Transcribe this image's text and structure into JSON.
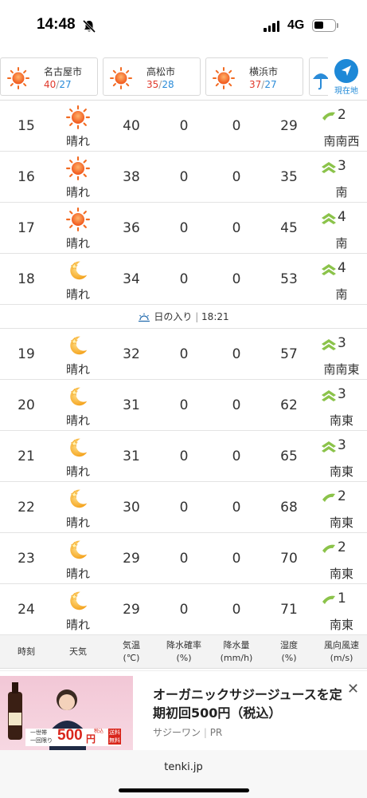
{
  "status": {
    "time": "14:48",
    "network": "4G"
  },
  "cities": [
    {
      "name": "名古屋市",
      "high": "40",
      "low": "27",
      "icon": "sun-icon"
    },
    {
      "name": "高松市",
      "high": "35",
      "low": "28",
      "icon": "sun-icon"
    },
    {
      "name": "横浜市",
      "high": "37",
      "low": "27",
      "icon": "sun-icon"
    }
  ],
  "locate_label": "現在地",
  "rows_before_sunset": [
    {
      "hour": "15",
      "icon": "sun-icon",
      "weather": "晴れ",
      "temp": "40",
      "prob": "0",
      "amount": "0",
      "humidity": "29",
      "speed": "2",
      "dir": "南南西",
      "wind_level": 1
    },
    {
      "hour": "16",
      "icon": "sun-icon",
      "weather": "晴れ",
      "temp": "38",
      "prob": "0",
      "amount": "0",
      "humidity": "35",
      "speed": "3",
      "dir": "南",
      "wind_level": 2
    },
    {
      "hour": "17",
      "icon": "sun-icon",
      "weather": "晴れ",
      "temp": "36",
      "prob": "0",
      "amount": "0",
      "humidity": "45",
      "speed": "4",
      "dir": "南",
      "wind_level": 2
    },
    {
      "hour": "18",
      "icon": "moon-icon",
      "weather": "晴れ",
      "temp": "34",
      "prob": "0",
      "amount": "0",
      "humidity": "53",
      "speed": "4",
      "dir": "南",
      "wind_level": 2
    }
  ],
  "sunset": {
    "label": "日の入り",
    "time": "18:21"
  },
  "rows_after_sunset": [
    {
      "hour": "19",
      "icon": "moon-icon",
      "weather": "晴れ",
      "temp": "32",
      "prob": "0",
      "amount": "0",
      "humidity": "57",
      "speed": "3",
      "dir": "南南東",
      "wind_level": 2
    },
    {
      "hour": "20",
      "icon": "moon-icon",
      "weather": "晴れ",
      "temp": "31",
      "prob": "0",
      "amount": "0",
      "humidity": "62",
      "speed": "3",
      "dir": "南東",
      "wind_level": 2
    },
    {
      "hour": "21",
      "icon": "moon-icon",
      "weather": "晴れ",
      "temp": "31",
      "prob": "0",
      "amount": "0",
      "humidity": "65",
      "speed": "3",
      "dir": "南東",
      "wind_level": 2
    },
    {
      "hour": "22",
      "icon": "moon-icon",
      "weather": "晴れ",
      "temp": "30",
      "prob": "0",
      "amount": "0",
      "humidity": "68",
      "speed": "2",
      "dir": "南東",
      "wind_level": 1
    },
    {
      "hour": "23",
      "icon": "moon-icon",
      "weather": "晴れ",
      "temp": "29",
      "prob": "0",
      "amount": "0",
      "humidity": "70",
      "speed": "2",
      "dir": "南東",
      "wind_level": 1
    },
    {
      "hour": "24",
      "icon": "moon-icon",
      "weather": "晴れ",
      "temp": "29",
      "prob": "0",
      "amount": "0",
      "humidity": "71",
      "speed": "1",
      "dir": "南東",
      "wind_level": 1
    }
  ],
  "headers": {
    "hour": "時刻",
    "weather": "天気",
    "temp_1": "気温",
    "temp_2": "(℃)",
    "prob_1": "降水確率",
    "prob_2": "(%)",
    "amount_1": "降水量",
    "amount_2": "(mm/h)",
    "hum_1": "湿度",
    "hum_2": "(%)",
    "wind_1": "風向風速",
    "wind_2": "(m/s)"
  },
  "ad": {
    "title": "オーガニックサジージュースを定期初回500円（税込）",
    "sponsor": "サジーワン",
    "pr": "PR",
    "close": "✕",
    "img_text_1": "一世帯",
    "img_text_2": "一回限り",
    "img_price": "500",
    "img_yen": "円",
    "img_tax": "税込",
    "img_free_1": "送料",
    "img_free_2": "無料"
  },
  "browser": {
    "url": "tenki.jp"
  },
  "colors": {
    "accent": "#1d88d7",
    "high": "#e0392b",
    "low": "#2a8bd8",
    "wind": "#8bc34a"
  }
}
